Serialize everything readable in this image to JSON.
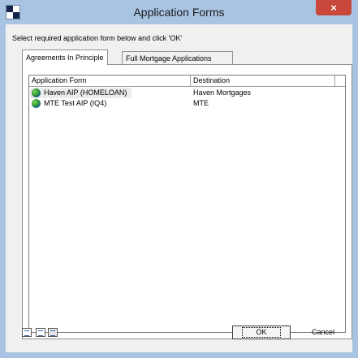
{
  "window": {
    "title": "Application Forms",
    "close_glyph": "×",
    "icon": "application-icon"
  },
  "instruction": "Select required application form below and click 'OK'",
  "tabs": [
    {
      "label": "Agreements In Principle",
      "active": true
    },
    {
      "label": "Full Mortgage Applications",
      "active": false
    }
  ],
  "list": {
    "columns": [
      "Application Form",
      "Destination",
      ""
    ],
    "rows": [
      {
        "form": "Haven AIP (HOMELOAN)",
        "destination": "Haven Mortgages",
        "icon": "globe-icon",
        "selected": true
      },
      {
        "form": "MTE Test AIP (IQ4)",
        "destination": "MTE",
        "icon": "globe-icon",
        "selected": false
      }
    ]
  },
  "view_buttons": [
    "large-icons-view-icon",
    "list-view-icon",
    "details-view-icon"
  ],
  "buttons": {
    "ok": "OK",
    "cancel": "Cancel"
  },
  "colors": {
    "title_bar": "#a9c4e3",
    "close_button": "#c9473b",
    "dialog_background": "#f0f0f0"
  }
}
